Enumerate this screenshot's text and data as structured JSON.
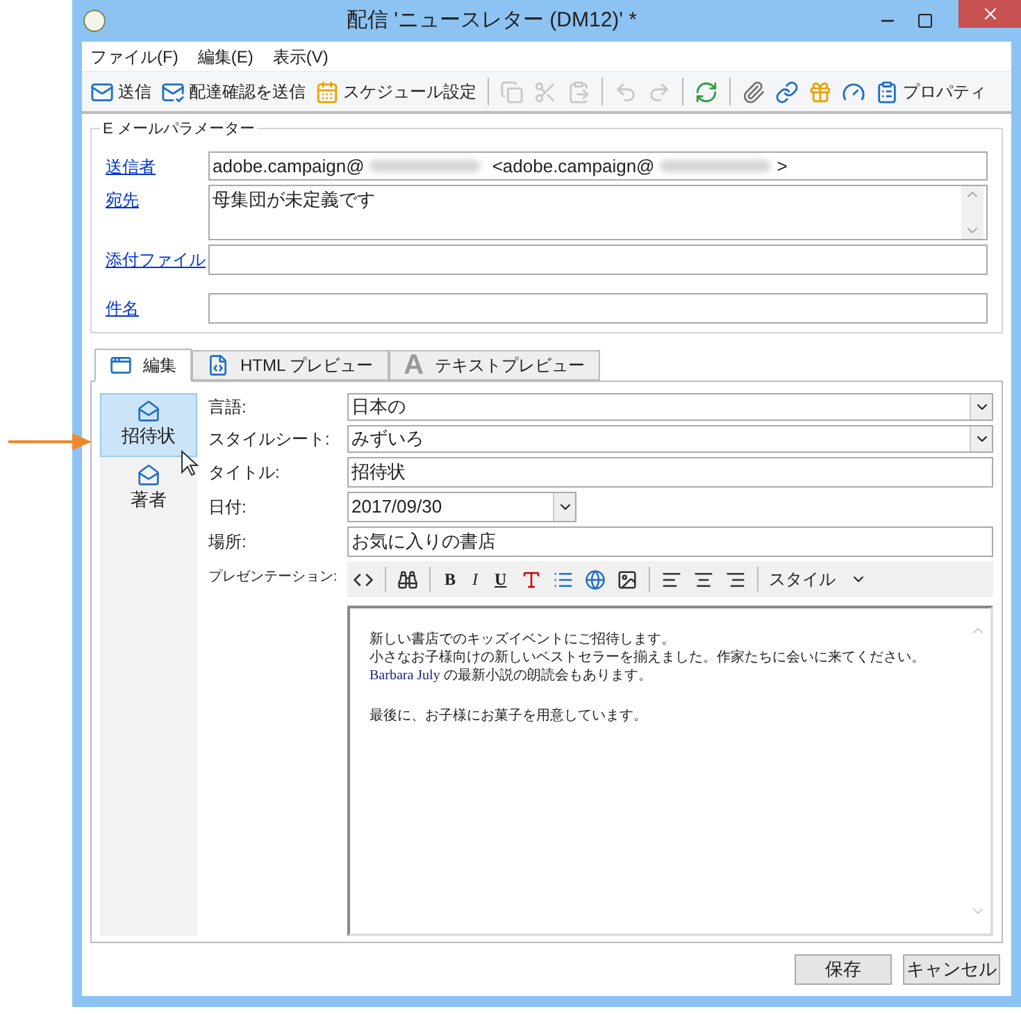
{
  "window": {
    "title": "配信 'ニュースレター (DM12)' *"
  },
  "menu": [
    {
      "label": "ファイル(F)"
    },
    {
      "label": "編集(E)"
    },
    {
      "label": "表示(V)"
    }
  ],
  "toolbar": [
    {
      "kind": "button",
      "label": "送信",
      "disabled": false
    },
    {
      "kind": "button",
      "label": "配達確認を送信",
      "disabled": false
    },
    {
      "kind": "button",
      "label": "スケジュール設定",
      "disabled": false
    },
    {
      "kind": "separator"
    },
    {
      "kind": "button",
      "disabled": true
    },
    {
      "kind": "button",
      "disabled": true
    },
    {
      "kind": "button",
      "disabled": true
    },
    {
      "kind": "separator"
    },
    {
      "kind": "button",
      "disabled": true
    },
    {
      "kind": "button",
      "disabled": true
    },
    {
      "kind": "separator"
    },
    {
      "kind": "button",
      "disabled": false
    },
    {
      "kind": "separator"
    },
    {
      "kind": "button",
      "disabled": false
    },
    {
      "kind": "button",
      "disabled": false
    },
    {
      "kind": "button",
      "disabled": false
    },
    {
      "kind": "button",
      "disabled": false
    },
    {
      "kind": "button",
      "label": "プロパティ",
      "disabled": false
    }
  ],
  "email_params": {
    "title": "E メールパラメーター",
    "sender": {
      "label": "送信者",
      "address": "adobe.campaign@",
      "reply_prefix": "<adobe.campaign@",
      "reply_suffix": ">"
    },
    "recipient": {
      "label": "宛先",
      "value": "母集団が未定義です"
    },
    "attachment": {
      "label": "添付ファイル"
    },
    "subject": {
      "label": "件名"
    }
  },
  "tabs": [
    {
      "label": "編集",
      "selected": true
    },
    {
      "label": "HTML プレビュー",
      "selected": false
    },
    {
      "label": "テキストプレビュー",
      "glyph": "A",
      "selected": false
    }
  ],
  "sections": [
    {
      "label": "招待状",
      "selected": true
    },
    {
      "label": "著者",
      "selected": false
    }
  ],
  "fields": [
    {
      "kind": "dropdown",
      "label": "言語:",
      "value": "日本の"
    },
    {
      "kind": "dropdown",
      "label": "スタイルシート:",
      "value": "みずいろ"
    },
    {
      "kind": "text",
      "label": "タイトル:",
      "value": "招待状"
    },
    {
      "kind": "date",
      "label": "日付:",
      "value": "2017/09/30"
    },
    {
      "kind": "text",
      "label": "場所:",
      "value": "お気に入りの書店"
    }
  ],
  "presentation": {
    "label": "プレゼンテーション:",
    "toolbar": [
      {
        "kind": "icon"
      },
      {
        "kind": "separator"
      },
      {
        "kind": "icon"
      },
      {
        "kind": "separator"
      },
      {
        "kind": "letter",
        "text": "B"
      },
      {
        "kind": "letter",
        "text": "I"
      },
      {
        "kind": "letter",
        "text": "U"
      },
      {
        "kind": "icon"
      },
      {
        "kind": "icon"
      },
      {
        "kind": "icon"
      },
      {
        "kind": "icon"
      },
      {
        "kind": "separator"
      },
      {
        "kind": "icon"
      },
      {
        "kind": "icon"
      },
      {
        "kind": "icon"
      },
      {
        "kind": "separator"
      },
      {
        "kind": "dropdown",
        "text": "スタイル"
      }
    ],
    "paragraphs": [
      {
        "segments": [
          {
            "kind": "plain",
            "text": "新しい書店でのキッズイベントにご招待します。"
          }
        ]
      },
      {
        "segments": [
          {
            "kind": "plain",
            "text": "小さなお子様向けの新しいベストセラーを揃えました。作家たちに会いに来てください。"
          },
          {
            "kind": "name",
            "text": "Barbara July"
          },
          {
            "kind": "plain",
            "text": " の最新小説の朗読会もあります。"
          }
        ]
      },
      {
        "segments": [
          {
            "kind": "plain",
            "text": "最後に、お子様にお菓子を用意しています。"
          }
        ]
      }
    ]
  },
  "buttons": [
    {
      "label": "保存"
    },
    {
      "label": "キャンセル"
    }
  ]
}
